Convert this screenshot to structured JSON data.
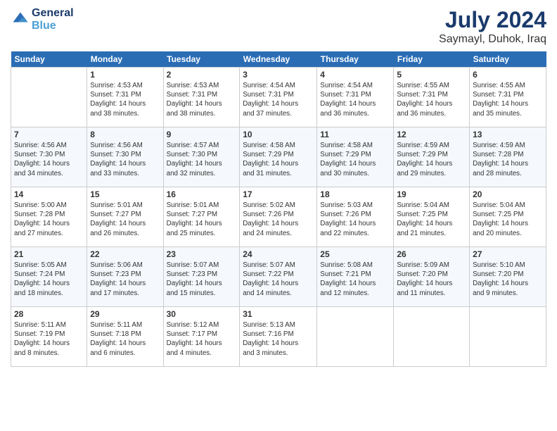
{
  "header": {
    "logo_line1": "General",
    "logo_line2": "Blue",
    "main_title": "July 2024",
    "subtitle": "Saymayl, Duhok, Iraq"
  },
  "days_of_week": [
    "Sunday",
    "Monday",
    "Tuesday",
    "Wednesday",
    "Thursday",
    "Friday",
    "Saturday"
  ],
  "weeks": [
    [
      {
        "day": "",
        "info": ""
      },
      {
        "day": "1",
        "info": "Sunrise: 4:53 AM\nSunset: 7:31 PM\nDaylight: 14 hours\nand 38 minutes."
      },
      {
        "day": "2",
        "info": "Sunrise: 4:53 AM\nSunset: 7:31 PM\nDaylight: 14 hours\nand 38 minutes."
      },
      {
        "day": "3",
        "info": "Sunrise: 4:54 AM\nSunset: 7:31 PM\nDaylight: 14 hours\nand 37 minutes."
      },
      {
        "day": "4",
        "info": "Sunrise: 4:54 AM\nSunset: 7:31 PM\nDaylight: 14 hours\nand 36 minutes."
      },
      {
        "day": "5",
        "info": "Sunrise: 4:55 AM\nSunset: 7:31 PM\nDaylight: 14 hours\nand 36 minutes."
      },
      {
        "day": "6",
        "info": "Sunrise: 4:55 AM\nSunset: 7:31 PM\nDaylight: 14 hours\nand 35 minutes."
      }
    ],
    [
      {
        "day": "7",
        "info": "Sunrise: 4:56 AM\nSunset: 7:30 PM\nDaylight: 14 hours\nand 34 minutes."
      },
      {
        "day": "8",
        "info": "Sunrise: 4:56 AM\nSunset: 7:30 PM\nDaylight: 14 hours\nand 33 minutes."
      },
      {
        "day": "9",
        "info": "Sunrise: 4:57 AM\nSunset: 7:30 PM\nDaylight: 14 hours\nand 32 minutes."
      },
      {
        "day": "10",
        "info": "Sunrise: 4:58 AM\nSunset: 7:29 PM\nDaylight: 14 hours\nand 31 minutes."
      },
      {
        "day": "11",
        "info": "Sunrise: 4:58 AM\nSunset: 7:29 PM\nDaylight: 14 hours\nand 30 minutes."
      },
      {
        "day": "12",
        "info": "Sunrise: 4:59 AM\nSunset: 7:29 PM\nDaylight: 14 hours\nand 29 minutes."
      },
      {
        "day": "13",
        "info": "Sunrise: 4:59 AM\nSunset: 7:28 PM\nDaylight: 14 hours\nand 28 minutes."
      }
    ],
    [
      {
        "day": "14",
        "info": "Sunrise: 5:00 AM\nSunset: 7:28 PM\nDaylight: 14 hours\nand 27 minutes."
      },
      {
        "day": "15",
        "info": "Sunrise: 5:01 AM\nSunset: 7:27 PM\nDaylight: 14 hours\nand 26 minutes."
      },
      {
        "day": "16",
        "info": "Sunrise: 5:01 AM\nSunset: 7:27 PM\nDaylight: 14 hours\nand 25 minutes."
      },
      {
        "day": "17",
        "info": "Sunrise: 5:02 AM\nSunset: 7:26 PM\nDaylight: 14 hours\nand 24 minutes."
      },
      {
        "day": "18",
        "info": "Sunrise: 5:03 AM\nSunset: 7:26 PM\nDaylight: 14 hours\nand 22 minutes."
      },
      {
        "day": "19",
        "info": "Sunrise: 5:04 AM\nSunset: 7:25 PM\nDaylight: 14 hours\nand 21 minutes."
      },
      {
        "day": "20",
        "info": "Sunrise: 5:04 AM\nSunset: 7:25 PM\nDaylight: 14 hours\nand 20 minutes."
      }
    ],
    [
      {
        "day": "21",
        "info": "Sunrise: 5:05 AM\nSunset: 7:24 PM\nDaylight: 14 hours\nand 18 minutes."
      },
      {
        "day": "22",
        "info": "Sunrise: 5:06 AM\nSunset: 7:23 PM\nDaylight: 14 hours\nand 17 minutes."
      },
      {
        "day": "23",
        "info": "Sunrise: 5:07 AM\nSunset: 7:23 PM\nDaylight: 14 hours\nand 15 minutes."
      },
      {
        "day": "24",
        "info": "Sunrise: 5:07 AM\nSunset: 7:22 PM\nDaylight: 14 hours\nand 14 minutes."
      },
      {
        "day": "25",
        "info": "Sunrise: 5:08 AM\nSunset: 7:21 PM\nDaylight: 14 hours\nand 12 minutes."
      },
      {
        "day": "26",
        "info": "Sunrise: 5:09 AM\nSunset: 7:20 PM\nDaylight: 14 hours\nand 11 minutes."
      },
      {
        "day": "27",
        "info": "Sunrise: 5:10 AM\nSunset: 7:20 PM\nDaylight: 14 hours\nand 9 minutes."
      }
    ],
    [
      {
        "day": "28",
        "info": "Sunrise: 5:11 AM\nSunset: 7:19 PM\nDaylight: 14 hours\nand 8 minutes."
      },
      {
        "day": "29",
        "info": "Sunrise: 5:11 AM\nSunset: 7:18 PM\nDaylight: 14 hours\nand 6 minutes."
      },
      {
        "day": "30",
        "info": "Sunrise: 5:12 AM\nSunset: 7:17 PM\nDaylight: 14 hours\nand 4 minutes."
      },
      {
        "day": "31",
        "info": "Sunrise: 5:13 AM\nSunset: 7:16 PM\nDaylight: 14 hours\nand 3 minutes."
      },
      {
        "day": "",
        "info": ""
      },
      {
        "day": "",
        "info": ""
      },
      {
        "day": "",
        "info": ""
      }
    ]
  ]
}
